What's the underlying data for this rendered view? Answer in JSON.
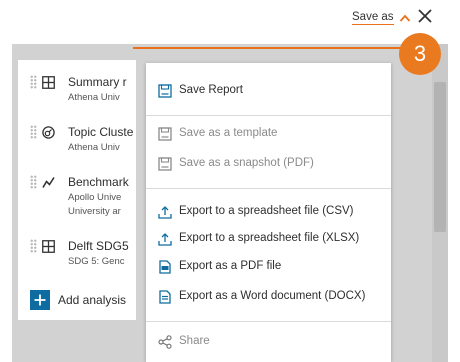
{
  "header": {
    "save_as_label": "Save as",
    "icons": {
      "caret": "chevron-up-icon",
      "close": "close-icon"
    },
    "accent_color": "#e9711c"
  },
  "badge": {
    "number": "3",
    "color": "#ea7a1f"
  },
  "analyses": [
    {
      "icon": "table-icon",
      "title": "Summary r",
      "lines": [
        "Athena Univ"
      ]
    },
    {
      "icon": "topic-cluster-icon",
      "title": "Topic Cluste",
      "lines": [
        "Athena Univ"
      ]
    },
    {
      "icon": "trend-line-icon",
      "title": "Benchmark",
      "lines": [
        "Apollo Unive",
        "University ar"
      ]
    },
    {
      "icon": "table-icon",
      "title": "Delft SDG5",
      "lines": [
        "SDG 5: Genc"
      ]
    }
  ],
  "add_analysis": {
    "label": "Add analysis",
    "icon": "plus-icon",
    "color": "#0e6ca0"
  },
  "menu": {
    "sections": [
      [
        {
          "icon": "save-icon",
          "label": "Save Report",
          "enabled": true
        }
      ],
      [
        {
          "icon": "save-icon",
          "label": "Save as a template",
          "enabled": false
        },
        {
          "icon": "save-icon",
          "label": "Save as a snapshot (PDF)",
          "enabled": false
        }
      ],
      [
        {
          "icon": "export-upload-icon",
          "label": "Export to a spreadsheet file (CSV)",
          "enabled": true
        },
        {
          "icon": "export-upload-icon",
          "label": "Export to a spreadsheet file (XLSX)",
          "enabled": true
        },
        {
          "icon": "pdf-file-icon",
          "label": "Export as a PDF file",
          "enabled": true
        },
        {
          "icon": "word-file-icon",
          "label": "Export as a Word document (DOCX)",
          "enabled": true
        }
      ],
      [
        {
          "icon": "share-icon",
          "label": "Share",
          "enabled": false
        }
      ]
    ],
    "icon_color": "#0e6ca0",
    "disabled_color": "#8a8a8a"
  }
}
